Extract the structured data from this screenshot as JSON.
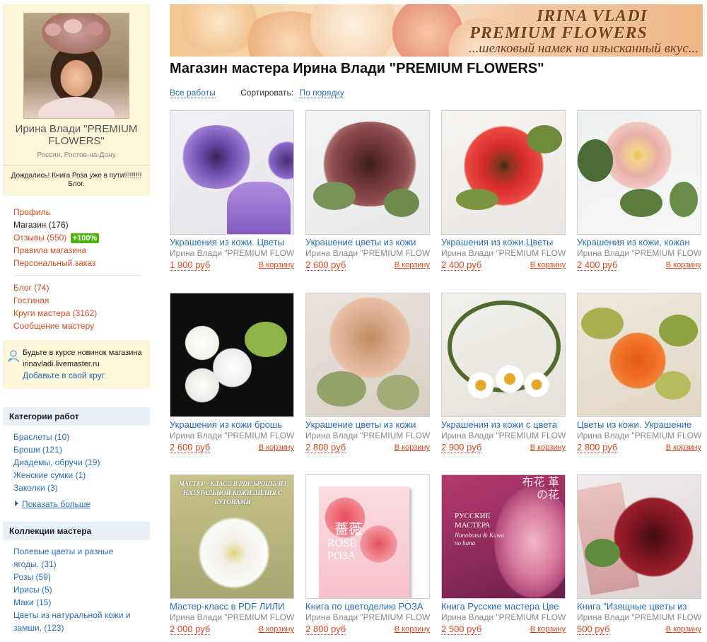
{
  "profile": {
    "name": "Ирина Влади \"PREMIUM FLOWERS\"",
    "location": "Россия, Ростов-на-Дону",
    "status": "Дождались! Книга Роза уже в пути!!!!!!!!! Блог."
  },
  "nav": {
    "group1": [
      {
        "label": "Профиль"
      },
      {
        "label": "Магазин (176)"
      },
      {
        "label": "Отзывы (550)",
        "badge": "+100%"
      },
      {
        "label": "Правила магазина"
      },
      {
        "label": "Персональный заказ"
      }
    ],
    "group2": [
      {
        "label": "Блог (74)"
      },
      {
        "label": "Гостиная"
      },
      {
        "label": "Круги мастера (3162)"
      },
      {
        "label": "Сообщение мастеру"
      }
    ]
  },
  "subscribe": {
    "text": "Будьте в курсе новинок магазина",
    "domain": "irinavladi.livemaster.ru",
    "link": "Добавьте в свой круг"
  },
  "categories": {
    "heading": "Категории работ",
    "items": [
      "Браслеты (10)",
      "Броши (121)",
      "Диадемы, обручи (19)",
      "Женские сумки (1)",
      "Заколки (3)"
    ],
    "show_more": "Показать больше"
  },
  "collections": {
    "heading": "Коллекции мастера",
    "items": [
      "Полевые цветы и разные ягоды. (31)",
      "Розы (59)",
      "Ирисы (5)",
      "Маки (15)",
      "Цветы из натуральной кожи и замши. (123)"
    ]
  },
  "banner": {
    "line1": "IRINA VLADI",
    "line2": "PREMIUM FLOWERS",
    "line3": "...шелковый намек на изысканный вкус..."
  },
  "shop": {
    "title": "Магазин мастера Ирина Влади \"PREMIUM FLOWERS\"",
    "all_works": "Все работы",
    "sort_label": "Сортировать:",
    "sort_value": "По порядку"
  },
  "products": [
    {
      "title": "Украшения из кожи. Цветы",
      "author": "Ирина Влади \"PREMIUM FLOWERS\"",
      "price": "1 900 руб",
      "cart": "В корзину"
    },
    {
      "title": "Украшение цветы из кожи",
      "author": "Ирина Влади \"PREMIUM FLOWERS\"",
      "price": "2 600 руб",
      "cart": "В корзину"
    },
    {
      "title": "Украшения из кожи.Цветы",
      "author": "Ирина Влади \"PREMIUM FLOWERS\"",
      "price": "2 400 руб",
      "cart": "В корзину"
    },
    {
      "title": "Украшения из кожи, кожан",
      "author": "Ирина Влади \"PREMIUM FLOWERS\"",
      "price": "2 400 руб",
      "cart": "В корзину"
    },
    {
      "title": "Украшения из кожи брошь",
      "author": "Ирина Влади \"PREMIUM FLOWERS\"",
      "price": "2 600 руб",
      "cart": "В корзину"
    },
    {
      "title": "Украшение цветы из кожи",
      "author": "Ирина Влади \"PREMIUM FLOWERS\"",
      "price": "2 800 руб",
      "cart": "В корзину"
    },
    {
      "title": "Украшения из кожи с цвета",
      "author": "Ирина Влади \"PREMIUM FLOWERS\"",
      "price": "2 900 руб",
      "cart": "В корзину"
    },
    {
      "title": "Цветы из кожи. Украшение",
      "author": "Ирина Влади \"PREMIUM FLOWERS\"",
      "price": "2 800 руб",
      "cart": "В корзину"
    },
    {
      "title": "Мастер-класс в PDF ЛИЛИ",
      "author": "Ирина Влади \"PREMIUM FLOWERS\"",
      "price": "2 000 руб",
      "cart": "В корзину"
    },
    {
      "title": "Книга по цветоделию РОЗА",
      "author": "Ирина Влади \"PREMIUM FLOWERS\"",
      "price": "2 800 руб",
      "cart": "В корзину"
    },
    {
      "title": "Книга Русские мастера Цве",
      "author": "Ирина Влади \"PREMIUM FLOWERS\"",
      "price": "2 500 руб",
      "cart": "В корзину"
    },
    {
      "title": "Книга \"Изящные цветы из",
      "author": "Ирина Влади \"PREMIUM FLOWERS\"",
      "price": "500 руб",
      "cart": "В корзину"
    }
  ],
  "thumb_text": {
    "lily_cover": "МАСТЕР - КЛАСС В PDF БРОШЬ ИЗ НАТУРАЛЬНОЙ КОЖИ ЛИЛИЯ С БУТОНАМИ",
    "rose_cover_cn": "薔薇",
    "rose_cover_en": "ROSE",
    "rose_cover_ru": "РОЗА",
    "masters_cover_jp": "布花 革の花",
    "masters_cover_ru": "РУССКИЕ МАСТЕРА",
    "masters_cover_sub": "Nunobana & Kawa no hana"
  }
}
